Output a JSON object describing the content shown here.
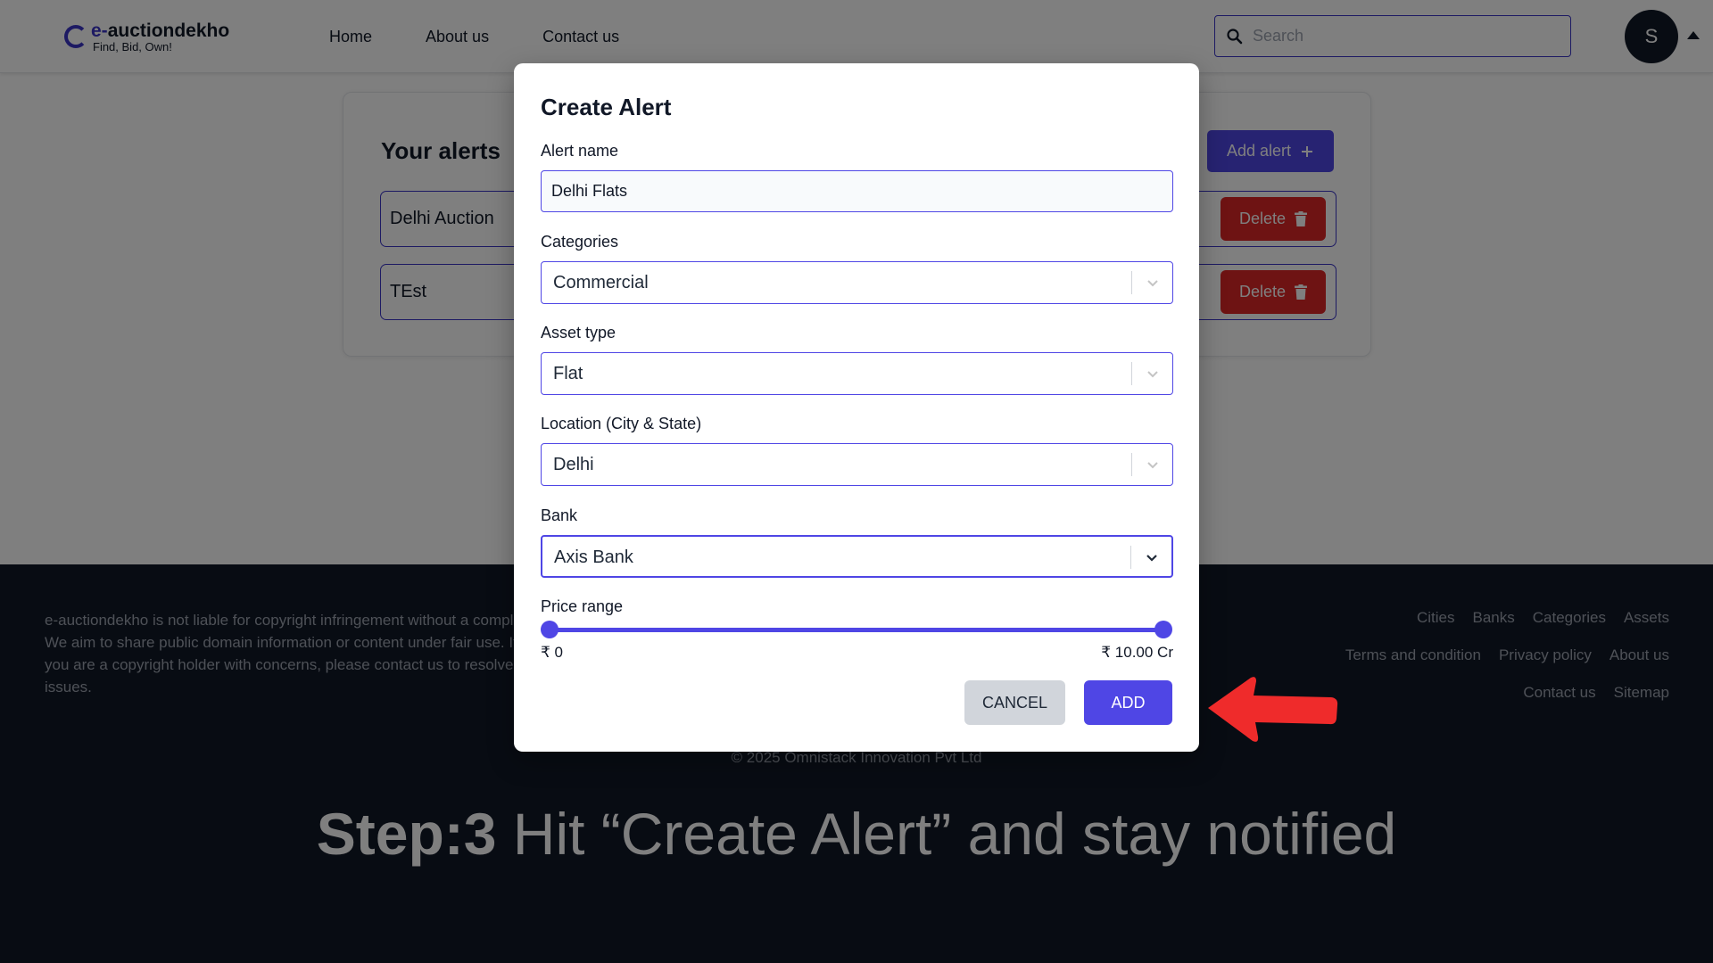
{
  "header": {
    "logo_title_accent": "e-",
    "logo_title_rest": "auctiondekho",
    "logo_tagline": "Find, Bid, Own!",
    "nav": [
      "Home",
      "About us",
      "Contact us"
    ],
    "search_placeholder": "Search",
    "avatar_initial": "S"
  },
  "alerts": {
    "title": "Your alerts",
    "add_label": "Add alert",
    "items": [
      {
        "name": "Delhi Auction",
        "delete_label": "Delete"
      },
      {
        "name": "TEst",
        "delete_label": "Delete"
      }
    ]
  },
  "modal": {
    "title": "Create Alert",
    "alert_name_label": "Alert name",
    "alert_name_value": "Delhi Flats",
    "categories_label": "Categories",
    "categories_value": "Commercial",
    "asset_type_label": "Asset type",
    "asset_type_value": "Flat",
    "location_label": "Location (City & State)",
    "location_value": "Delhi",
    "bank_label": "Bank",
    "bank_value": "Axis Bank",
    "price_label": "Price range",
    "price_min": "₹ 0",
    "price_max": "₹ 10.00 Cr",
    "slider_min_fraction": 0.0,
    "slider_max_fraction": 1.0,
    "cancel_label": "CANCEL",
    "add_label": "ADD"
  },
  "footer": {
    "disclaimer": "e-auctiondekho is not liable for copyright infringement without a complaint. We aim to share public domain information or content under fair use. If you are a copyright holder with concerns, please contact us to resolve any issues.",
    "links_row1": [
      "Cities",
      "Banks",
      "Categories",
      "Assets"
    ],
    "links_row2": [
      "Terms and condition",
      "Privacy policy",
      "About us"
    ],
    "links_row3": [
      "Contact us",
      "Sitemap"
    ],
    "copyright": "© 2025 Omnistack Innovation Pvt Ltd"
  },
  "caption": {
    "bold": "Step:3",
    "rest": " Hit “Create Alert” and stay notified"
  },
  "colors": {
    "accent": "#4f46e5",
    "danger": "#dc2626",
    "footer_bg": "#111827",
    "arrow": "#ef2b2b"
  }
}
